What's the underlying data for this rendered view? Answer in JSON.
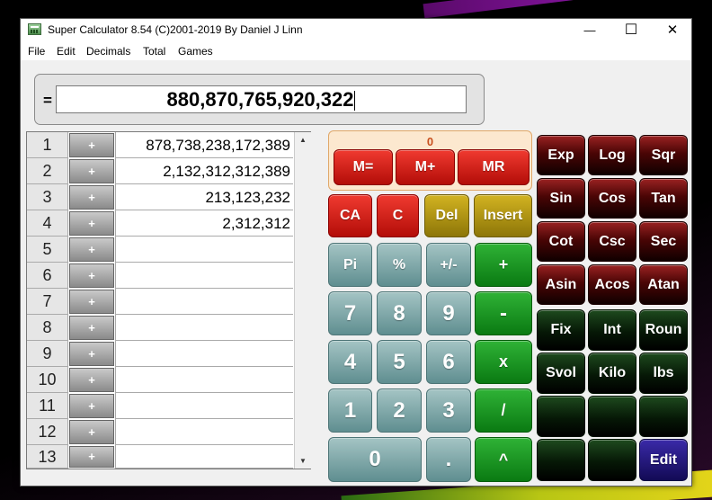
{
  "window": {
    "title": "Super Calculator 8.54 (C)2001-2019 By Daniel J Linn",
    "minimize_glyph": "—",
    "maximize_glyph": "☐",
    "close_glyph": "✕"
  },
  "menu": [
    "File",
    "Edit",
    "Decimals",
    "Total",
    "Games"
  ],
  "display": {
    "label": "=",
    "value": "880,870,765,920,322"
  },
  "tape": {
    "plus_label": "+",
    "rows": [
      {
        "num": "1",
        "value": "878,738,238,172,389"
      },
      {
        "num": "2",
        "value": "2,132,312,312,389"
      },
      {
        "num": "3",
        "value": "213,123,232"
      },
      {
        "num": "4",
        "value": "2,312,312"
      },
      {
        "num": "5",
        "value": ""
      },
      {
        "num": "6",
        "value": ""
      },
      {
        "num": "7",
        "value": ""
      },
      {
        "num": "8",
        "value": ""
      },
      {
        "num": "9",
        "value": ""
      },
      {
        "num": "10",
        "value": ""
      },
      {
        "num": "11",
        "value": ""
      },
      {
        "num": "12",
        "value": ""
      },
      {
        "num": "13",
        "value": ""
      }
    ],
    "scroll_up_glyph": "▲",
    "scroll_down_glyph": "▼"
  },
  "memory": {
    "value": "0",
    "buttons": [
      "M=",
      "M+",
      "MR"
    ]
  },
  "keypad": {
    "ca": "CA",
    "c": "C",
    "del": "Del",
    "insert": "Insert",
    "pi": "Pi",
    "percent": "%",
    "sign": "+/-",
    "plus": "+",
    "d7": "7",
    "d8": "8",
    "d9": "9",
    "minus": "-",
    "d4": "4",
    "d5": "5",
    "d6": "6",
    "multiply": "x",
    "d1": "1",
    "d2": "2",
    "d3": "3",
    "divide": "/",
    "d0": "0",
    "dot": ".",
    "power": "^"
  },
  "functions": {
    "exp": "Exp",
    "log": "Log",
    "sqr": "Sqr",
    "sin": "Sin",
    "cos": "Cos",
    "tan": "Tan",
    "cot": "Cot",
    "csc": "Csc",
    "sec": "Sec",
    "asin": "Asin",
    "acos": "Acos",
    "atan": "Atan",
    "fix": "Fix",
    "int": "Int",
    "round": "Roun",
    "svol": "Svol",
    "kilo": "Kilo",
    "lbs": "lbs",
    "edit": "Edit"
  },
  "colors": {
    "red": "#d91f18",
    "olive": "#b09614",
    "teal": "#7aa6a7",
    "green": "#129a1b",
    "maroon": "#5a0a0a",
    "dark_green": "#0b250b",
    "purple": "#241780",
    "memory_bg": "#fce8cf",
    "memory_text": "#c8501e"
  }
}
